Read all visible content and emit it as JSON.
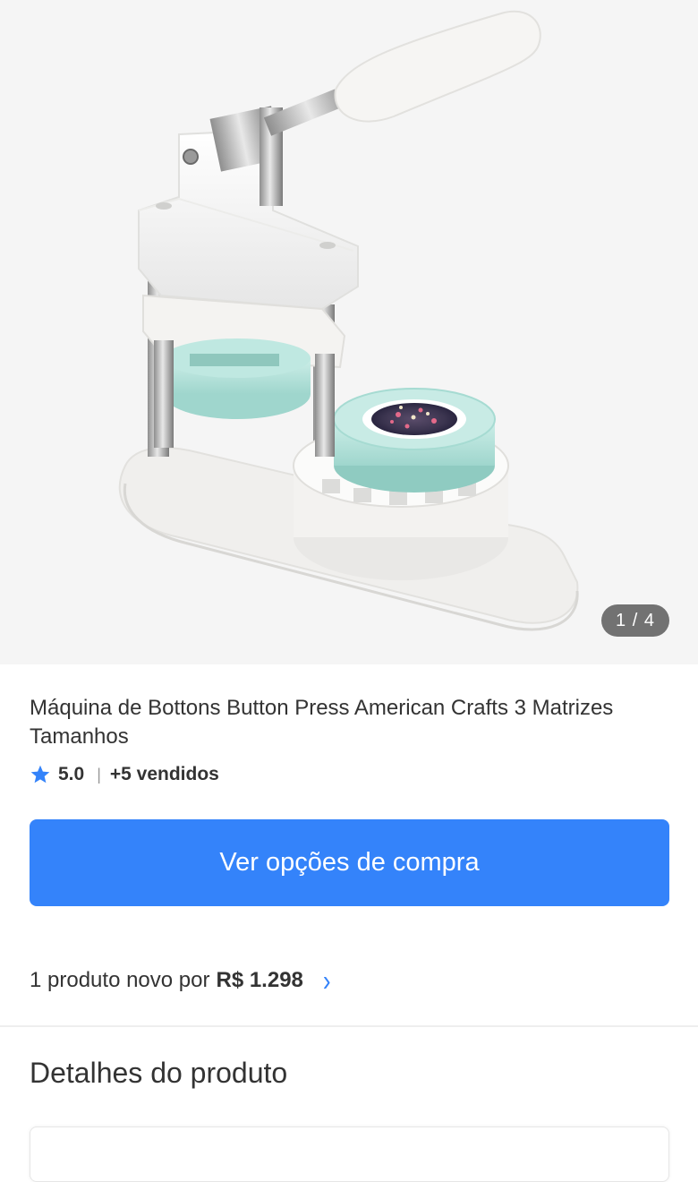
{
  "gallery": {
    "image_alt": "Máquina de Bottons Button Press",
    "page_indicator": "1 / 4"
  },
  "product": {
    "title_line1": "Máquina de Bottons Button Press American Crafts 3 Matrizes",
    "title_line2": "Tamanhos",
    "rating": "5.0",
    "separator": "|",
    "sold": "+5 vendidos"
  },
  "actions": {
    "buy_label": "Ver opções de compra"
  },
  "offer": {
    "text": "1 produto novo por",
    "price": "R$ 1.298",
    "chevron": "›"
  },
  "details": {
    "heading": "Detalhes do produto"
  },
  "colors": {
    "accent": "#3483fa",
    "gallery_bg": "#f5f5f5",
    "mint": "#b9e3dc"
  },
  "icons": {
    "rating": "star-icon",
    "offer": "chevron-right-icon"
  }
}
